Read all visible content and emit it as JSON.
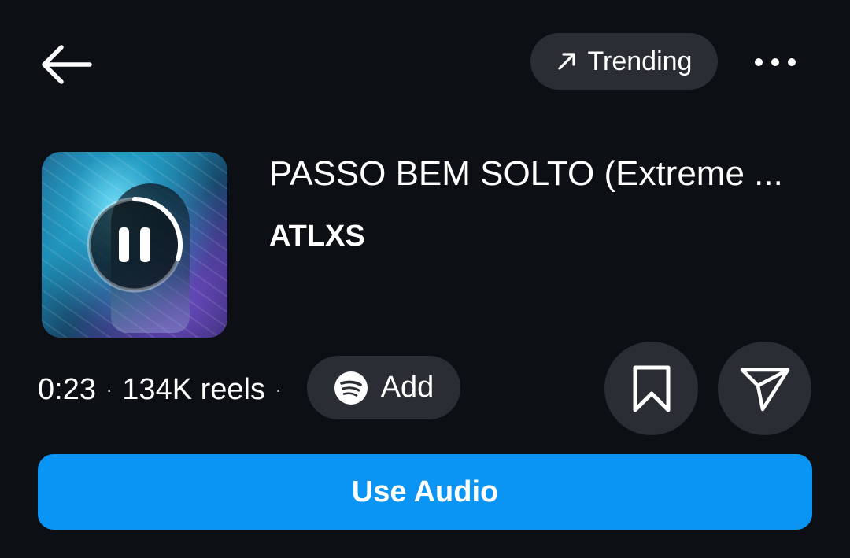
{
  "header": {
    "trending_label": "Trending",
    "trending_icon": "arrow-up-right-icon",
    "back_icon": "arrow-left-icon",
    "more_icon": "more-horizontal-icon"
  },
  "track": {
    "title": "PASSO BEM SOLTO (Extreme ...",
    "artist": "ATLXS",
    "playback_state": "playing",
    "playback_progress": 0.3
  },
  "meta": {
    "duration": "0:23",
    "separator": "·",
    "reels_count": "134K reels",
    "add_label": "Add",
    "add_icon": "spotify-icon"
  },
  "actions": {
    "save_icon": "bookmark-icon",
    "share_icon": "send-icon",
    "use_audio_label": "Use Audio"
  },
  "colors": {
    "background": "#0c0f14",
    "surface": "#2a2d33",
    "primary": "#0a95f5",
    "text": "#ffffff"
  }
}
